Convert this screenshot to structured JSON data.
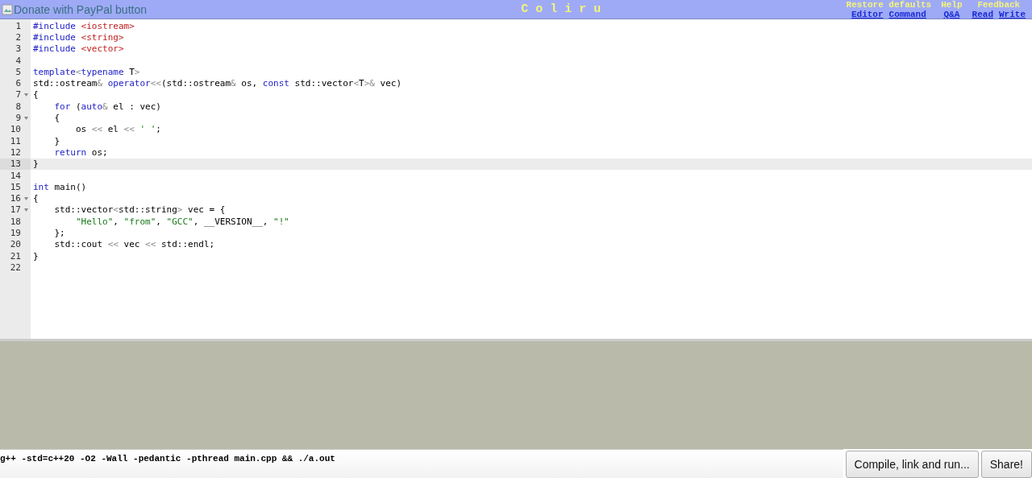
{
  "header": {
    "donate_alt": "Donate with PayPal button",
    "title": "C o l i r u",
    "menus": [
      {
        "label": "Restore defaults",
        "links": [
          "Editor",
          "Command"
        ]
      },
      {
        "label": "Help",
        "links": [
          "Q&A"
        ]
      },
      {
        "label": "Feedback",
        "links": [
          "Read",
          "Write"
        ]
      }
    ]
  },
  "editor": {
    "lines": [
      {
        "number": "1",
        "fold": false,
        "selected": false,
        "tokens": [
          {
            "kind": "kw",
            "text": "#include "
          },
          {
            "kind": "header",
            "text": "<iostream>"
          }
        ]
      },
      {
        "number": "2",
        "fold": false,
        "selected": false,
        "tokens": [
          {
            "kind": "kw",
            "text": "#include "
          },
          {
            "kind": "header",
            "text": "<string>"
          }
        ]
      },
      {
        "number": "3",
        "fold": false,
        "selected": false,
        "tokens": [
          {
            "kind": "kw",
            "text": "#include "
          },
          {
            "kind": "header",
            "text": "<vector>"
          }
        ]
      },
      {
        "number": "4",
        "fold": false,
        "selected": false
      },
      {
        "number": "5",
        "fold": false,
        "selected": false,
        "tokens": [
          {
            "kind": "kw",
            "text": "template"
          },
          {
            "kind": "op",
            "text": "<"
          },
          {
            "kind": "kw",
            "text": "typename"
          },
          {
            "kind": "text",
            "text": " T"
          },
          {
            "kind": "op",
            "text": ">"
          }
        ]
      },
      {
        "number": "6",
        "fold": false,
        "selected": false,
        "tokens": [
          {
            "kind": "text",
            "text": "std::ostream"
          },
          {
            "kind": "op",
            "text": "&"
          },
          {
            "kind": "kw",
            "text": " operator"
          },
          {
            "kind": "op",
            "text": "<<"
          },
          {
            "kind": "text",
            "text": "(std::ostream"
          },
          {
            "kind": "op",
            "text": "&"
          },
          {
            "kind": "text",
            "text": " os, "
          },
          {
            "kind": "kw",
            "text": "const"
          },
          {
            "kind": "text",
            "text": " std::vector"
          },
          {
            "kind": "op",
            "text": "<"
          },
          {
            "kind": "text",
            "text": "T"
          },
          {
            "kind": "op",
            "text": ">&"
          },
          {
            "kind": "text",
            "text": " vec)"
          }
        ]
      },
      {
        "number": "7",
        "fold": true,
        "selected": false,
        "tokens": [
          {
            "kind": "text",
            "text": "{"
          }
        ]
      },
      {
        "number": "8",
        "fold": false,
        "selected": false,
        "tokens": [
          {
            "kind": "kw",
            "text": "    for"
          },
          {
            "kind": "text",
            "text": " ("
          },
          {
            "kind": "kw",
            "text": "auto"
          },
          {
            "kind": "op",
            "text": "&"
          },
          {
            "kind": "text",
            "text": " el : vec)"
          }
        ]
      },
      {
        "number": "9",
        "fold": true,
        "selected": false,
        "tokens": [
          {
            "kind": "text",
            "text": "    {"
          }
        ]
      },
      {
        "number": "10",
        "fold": false,
        "selected": false,
        "tokens": [
          {
            "kind": "text",
            "text": "        os "
          },
          {
            "kind": "op",
            "text": "<<"
          },
          {
            "kind": "text",
            "text": " el "
          },
          {
            "kind": "op",
            "text": "<< "
          },
          {
            "kind": "str",
            "text": "' '"
          },
          {
            "kind": "text",
            "text": ";"
          }
        ]
      },
      {
        "number": "11",
        "fold": false,
        "selected": false,
        "tokens": [
          {
            "kind": "text",
            "text": "    }"
          }
        ]
      },
      {
        "number": "12",
        "fold": false,
        "selected": false,
        "tokens": [
          {
            "kind": "kw",
            "text": "    return"
          },
          {
            "kind": "text",
            "text": " os;"
          }
        ]
      },
      {
        "number": "13",
        "fold": false,
        "selected": true,
        "tokens": [
          {
            "kind": "text",
            "text": "}"
          }
        ]
      },
      {
        "number": "14",
        "fold": false,
        "selected": false
      },
      {
        "number": "15",
        "fold": false,
        "selected": false,
        "tokens": [
          {
            "kind": "kw",
            "text": "int"
          },
          {
            "kind": "text",
            "text": " main()"
          }
        ]
      },
      {
        "number": "16",
        "fold": true,
        "selected": false,
        "tokens": [
          {
            "kind": "text",
            "text": "{"
          }
        ]
      },
      {
        "number": "17",
        "fold": true,
        "selected": false,
        "tokens": [
          {
            "kind": "text",
            "text": "    std::vector"
          },
          {
            "kind": "op",
            "text": "<"
          },
          {
            "kind": "text",
            "text": "std::string"
          },
          {
            "kind": "op",
            "text": ">"
          },
          {
            "kind": "text",
            "text": " vec = {"
          }
        ]
      },
      {
        "number": "18",
        "fold": false,
        "selected": false,
        "tokens": [
          {
            "kind": "str",
            "text": "        \"Hello\""
          },
          {
            "kind": "text",
            "text": ", "
          },
          {
            "kind": "str",
            "text": "\"from\""
          },
          {
            "kind": "text",
            "text": ", "
          },
          {
            "kind": "str",
            "text": "\"GCC\""
          },
          {
            "kind": "text",
            "text": ", __VERSION__, "
          },
          {
            "kind": "str",
            "text": "\"!\""
          }
        ]
      },
      {
        "number": "19",
        "fold": false,
        "selected": false,
        "tokens": [
          {
            "kind": "text",
            "text": "    };"
          }
        ]
      },
      {
        "number": "20",
        "fold": false,
        "selected": false,
        "tokens": [
          {
            "kind": "text",
            "text": "    std::cout "
          },
          {
            "kind": "op",
            "text": "<<"
          },
          {
            "kind": "text",
            "text": " vec "
          },
          {
            "kind": "op",
            "text": "<<"
          },
          {
            "kind": "text",
            "text": " std::endl;"
          }
        ]
      },
      {
        "number": "21",
        "fold": false,
        "selected": false,
        "tokens": [
          {
            "kind": "text",
            "text": "}"
          }
        ]
      },
      {
        "number": "22",
        "fold": false,
        "selected": false
      }
    ]
  },
  "command": {
    "value": "g++ -std=c++20 -O2 -Wall -pedantic -pthread main.cpp && ./a.out"
  },
  "buttons": [
    "Compile, link and run...",
    "Share!"
  ]
}
